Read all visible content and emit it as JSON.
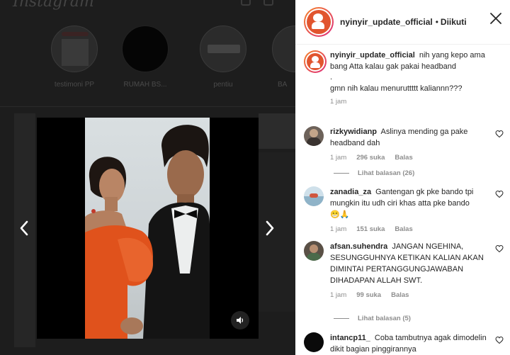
{
  "background_page": {
    "logo": "Instagram",
    "highlights": [
      {
        "label": "testimoni PP"
      },
      {
        "label": "RUMAH BS..."
      },
      {
        "label": "pentiu"
      },
      {
        "label": "BA"
      }
    ]
  },
  "colors": {
    "dress": "#e0521c",
    "suit": "#141414",
    "link_gray": "#8e8e8e"
  },
  "post": {
    "username": "nyinyir_update_official",
    "separator": "•",
    "follow_status": "Diikuti",
    "caption_line1": "nih yang kepo ama bang Atta kalau gak pakai headband",
    "caption_line2": ".",
    "caption_line3": "gmn nih kalau menuruttttt kaliannn???",
    "time": "1 jam"
  },
  "comments": [
    {
      "username": "rizkywidianp",
      "text": "Aslinya mending ga pake headband dah",
      "time": "1 jam",
      "likes": "296 suka",
      "reply": "Balas",
      "view_replies": "Lihat balasan (26)"
    },
    {
      "username": "zanadia_za",
      "text": "Gantengan gk pke bando tpi mungkin itu udh ciri khas atta pke bando",
      "emoji": "😁🙏",
      "time": "1 jam",
      "likes": "151 suka",
      "reply": "Balas"
    },
    {
      "username": "afsan.suhendra",
      "text": "JANGAN NGEHINA, SESUNGGUHNYA KETIKAN KALIAN AKAN DIMINTAI PERTANGGUNGJAWABAN DIHADAPAN ALLAH SWT.",
      "time": "1 jam",
      "likes": "99 suka",
      "reply": "Balas",
      "view_replies": "Lihat balasan (5)"
    },
    {
      "username": "intancp11_",
      "text": "Coba tambutnya agak dimodelin dikit bagian pinggirannya"
    }
  ]
}
